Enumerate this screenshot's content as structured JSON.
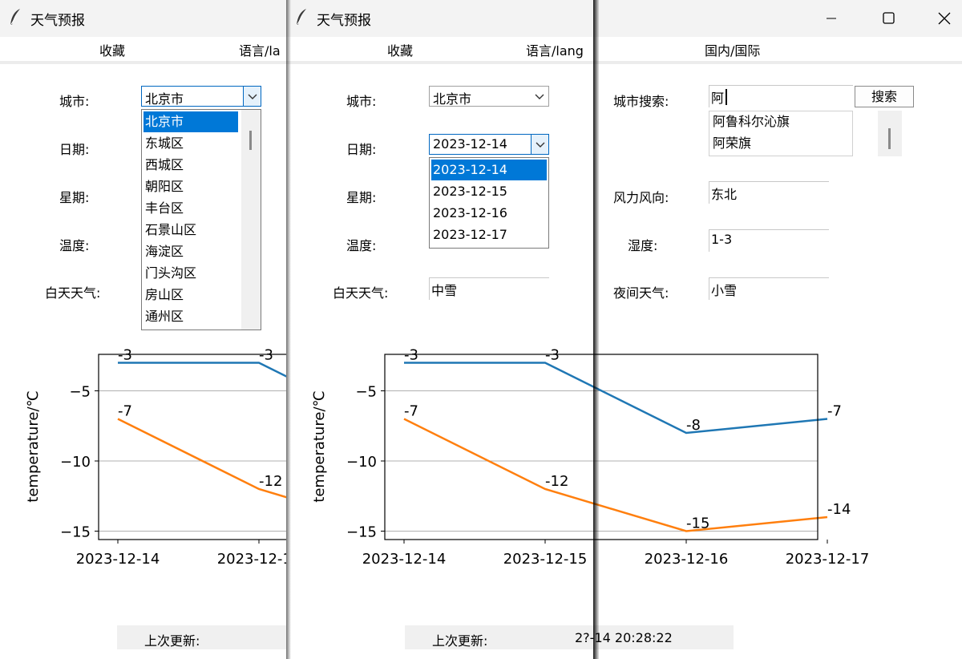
{
  "window": {
    "title": "天气预报",
    "controls": [
      "minimize-icon",
      "maximize-icon",
      "close-icon"
    ]
  },
  "menu": {
    "favorites": "收藏",
    "language": "语言/language",
    "domestic_international": "国内/国际"
  },
  "left": {
    "menu_language_truncated": "语言/la",
    "city_label": "城市:",
    "city_value": "北京市",
    "date_label": "日期:",
    "weekday_label": "星期:",
    "temp_label": "温度:",
    "day_weather_label": "白天天气:",
    "city_list": [
      "北京市",
      "东城区",
      "西城区",
      "朝阳区",
      "丰台区",
      "石景山区",
      "海淀区",
      "门头沟区",
      "房山区",
      "通州区"
    ],
    "status_label": "上次更新:"
  },
  "middle": {
    "city_label": "城市:",
    "city_value": "北京市",
    "date_label": "日期:",
    "date_value": "2023-12-14",
    "date_options": [
      "2023-12-14",
      "2023-12-15",
      "2023-12-16",
      "2023-12-17"
    ],
    "weekday_label": "星期:",
    "temp_label": "温度:",
    "day_weather_label": "白天天气:",
    "day_weather_value": "中雪",
    "menu_language_truncated": "语言/lang",
    "status_label": "上次更新:",
    "status_time_visible": "2?-14 20:28:22"
  },
  "right": {
    "city_search_label": "城市搜索:",
    "city_search_value": "阿",
    "search_button": "搜索",
    "search_results": [
      "阿鲁科尔沁旗",
      "阿荣旗"
    ],
    "wind_label": "风力风向:",
    "wind_value": "东北",
    "wind_level_label": "湿度:",
    "wind_level_value": "1-3",
    "night_weather_label": "夜间天气:",
    "night_weather_value": "小雪"
  },
  "chart_data": {
    "type": "line",
    "ylabel": "temperature/℃",
    "x": [
      "2023-12-14",
      "2023-12-15",
      "2023-12-16",
      "2023-12-17"
    ],
    "yticks": [
      -5,
      -10,
      -15
    ],
    "ylim": [
      -15.6,
      -2.4
    ],
    "grid": "horizontal",
    "series": [
      {
        "name": "",
        "color": "#1f77b4",
        "values": [
          -3,
          -3,
          -8,
          -7
        ],
        "labels": [
          "-3",
          "-3",
          "-8",
          "-7"
        ]
      },
      {
        "name": "",
        "color": "#ff7f0e",
        "values": [
          -7,
          -12,
          -15,
          -14
        ],
        "labels": [
          "-7",
          "-12",
          "-15",
          "-14"
        ]
      }
    ]
  }
}
